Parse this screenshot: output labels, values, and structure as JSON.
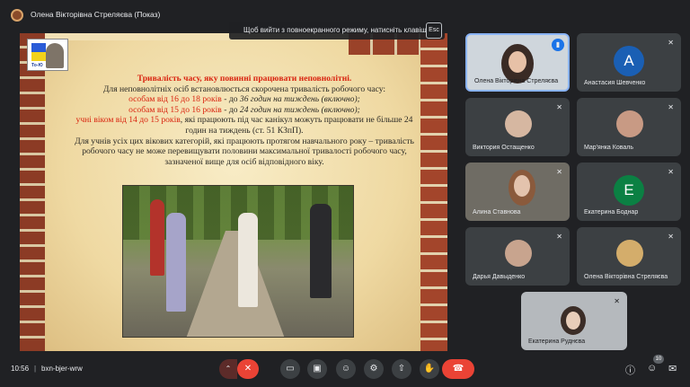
{
  "presenter": {
    "title": "Олена Вікторівна Стреляєва (Показ)"
  },
  "fullscreen_hint": {
    "text": "Щоб вийти з повноекранного режиму, натисніть клавішу",
    "key": "Esc"
  },
  "slide": {
    "logo_text": "То-Ю",
    "heading": "Тривалість часу, яку повинні працювати неповнолітні.",
    "line1": "Для неповнолітніх осіб встановлюється скорочена тривалість робочого часу:",
    "line2_red": "особам від 16 до 18 років",
    "line2_rest": " - до ",
    "line2_it": "36 годин на тиждень (включно);",
    "line3_red": "особам від 15 до 16 років",
    "line3_rest": " - до ",
    "line3_it": "24 годин на тиждень (включно);",
    "line4_red": "учні віком від 14 до 15 років",
    "line4_rest": ", які працюють під час канікул можуть працювати не більше 24 годин на тиждень (ст. 51 КЗпП).",
    "line5": "Для учнів усіх цих вікових категорій, які працюють протягом навчального року – тривалість робочого часу не може перевищувати половини максимальної тривалості робочого часу, зазначеної вище для осіб відповідного віку."
  },
  "participants": [
    {
      "name": "Олена Вікторівна Стреляєва",
      "type": "video"
    },
    {
      "name": "Анастасия Шевченко",
      "type": "avatar",
      "initial": "A",
      "color": "#1a5fb4"
    },
    {
      "name": "Виктория Остащенко",
      "type": "video"
    },
    {
      "name": "Мар'янка Коваль",
      "type": "video"
    },
    {
      "name": "Алина Ставнова",
      "type": "video"
    },
    {
      "name": "Екатерина Боднар",
      "type": "avatar",
      "initial": "E",
      "color": "#0b8043"
    },
    {
      "name": "Дарья Давыденко",
      "type": "video"
    },
    {
      "name": "Олена Вікторівна Стреляєва",
      "type": "video"
    },
    {
      "name": "Екатерина Руднєва",
      "type": "video"
    }
  ],
  "bottom": {
    "time": "10:56",
    "separator": "|",
    "meeting_code": "bxn-bjer-wrw",
    "participants_count": "10"
  },
  "colors": {
    "end_call": "#ea4335",
    "mic_off": "#ea4335",
    "speaking_border": "#8ab4f8"
  }
}
